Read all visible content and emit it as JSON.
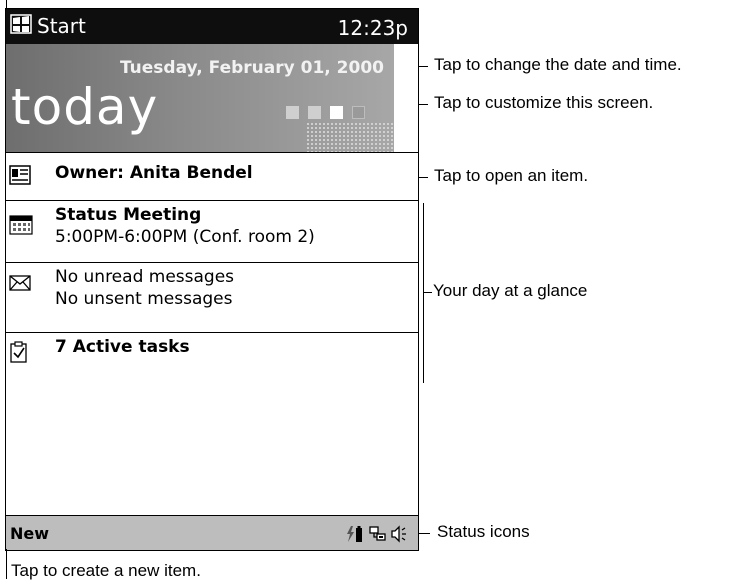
{
  "titlebar": {
    "start_label": "Start",
    "clock": "12:23p"
  },
  "today": {
    "date": "Tuesday, February 01, 2000",
    "title": "today"
  },
  "items": {
    "owner": {
      "label": "Owner: Anita Bendel",
      "icon": "owner-card-icon"
    },
    "calendar": {
      "title": "Status Meeting",
      "detail": "5:00PM-6:00PM (Conf. room 2)",
      "icon": "calendar-icon"
    },
    "inbox": {
      "line1": "No unread messages",
      "line2": "No unsent messages",
      "icon": "envelope-icon"
    },
    "tasks": {
      "label": "7 Active tasks",
      "icon": "tasks-icon"
    }
  },
  "menubar": {
    "new_label": "New",
    "status_icons": [
      "power-icon",
      "connection-icon",
      "speaker-icon"
    ]
  },
  "callouts": {
    "date_time": "Tap to change the date and time.",
    "customize": "Tap to customize this screen.",
    "open_item": "Tap to open an item.",
    "glance": "Your day at a glance",
    "status": "Status icons",
    "new_item": "Tap to create a new item."
  }
}
